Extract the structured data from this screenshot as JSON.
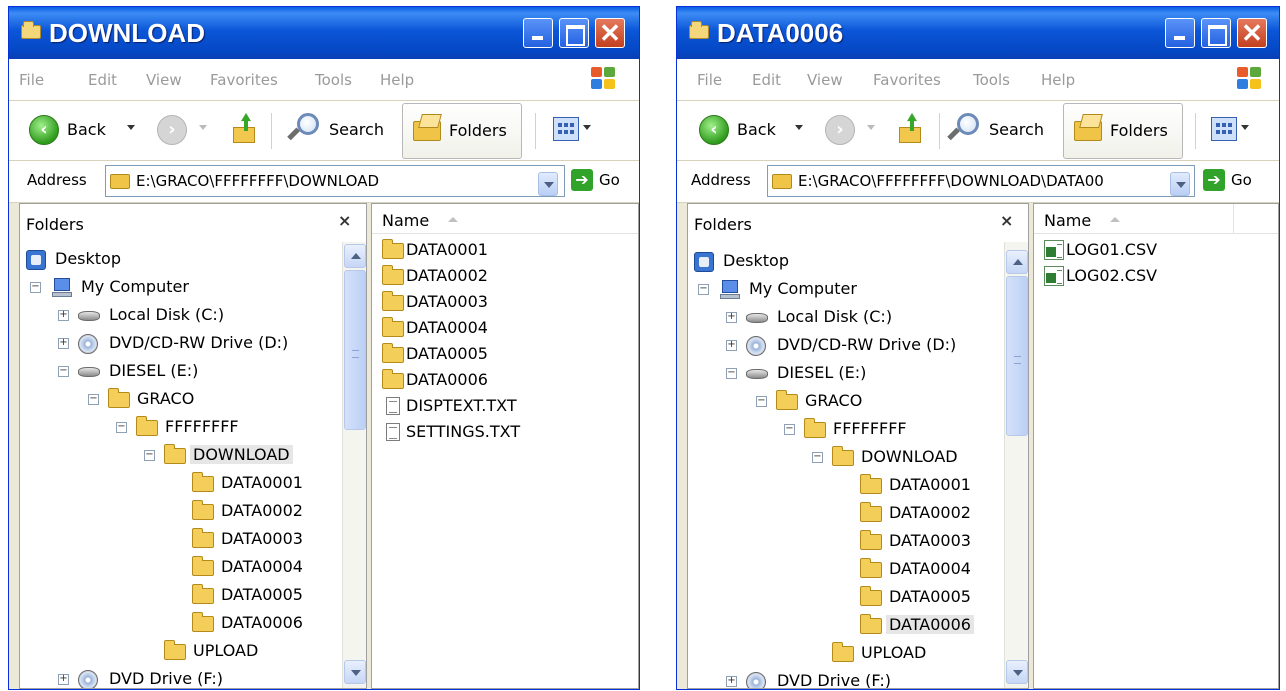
{
  "windows": [
    {
      "title": "DOWNLOAD",
      "menu": [
        "File",
        "Edit",
        "View",
        "Favorites",
        "Tools",
        "Help"
      ],
      "toolbar": {
        "back": "Back",
        "search": "Search",
        "folders": "Folders"
      },
      "address": {
        "label": "Address",
        "value": "E:\\GRACO\\FFFFFFFF\\DOWNLOAD",
        "go": "Go"
      },
      "folders_pane": {
        "title": "Folders",
        "close": "×",
        "tree": [
          {
            "label": "Desktop",
            "icon": "desktop-icon"
          },
          {
            "label": "My Computer",
            "icon": "computer-icon",
            "expander": "−"
          },
          {
            "label": "Local Disk (C:)",
            "icon": "disk-icon",
            "expander": "+"
          },
          {
            "label": "DVD/CD-RW Drive (D:)",
            "icon": "dvd-icon",
            "expander": "+"
          },
          {
            "label": "DIESEL (E:)",
            "icon": "disk-icon",
            "expander": "−"
          },
          {
            "label": "GRACO",
            "icon": "folder-icon",
            "expander": "−"
          },
          {
            "label": "FFFFFFFF",
            "icon": "folder-icon",
            "expander": "−"
          },
          {
            "label": "DOWNLOAD",
            "icon": "folder-icon",
            "expander": "−",
            "selected": true
          },
          {
            "label": "DATA0001",
            "icon": "folder-icon"
          },
          {
            "label": "DATA0002",
            "icon": "folder-icon"
          },
          {
            "label": "DATA0003",
            "icon": "folder-icon"
          },
          {
            "label": "DATA0004",
            "icon": "folder-icon"
          },
          {
            "label": "DATA0005",
            "icon": "folder-icon"
          },
          {
            "label": "DATA0006",
            "icon": "folder-icon"
          },
          {
            "label": "UPLOAD",
            "icon": "folder-icon"
          },
          {
            "label": "DVD Drive (F:)",
            "icon": "dvd-icon",
            "expander": "+"
          }
        ]
      },
      "files": {
        "column": "Name",
        "items": [
          {
            "name": "DATA0001",
            "icon": "folder-icon"
          },
          {
            "name": "DATA0002",
            "icon": "folder-icon"
          },
          {
            "name": "DATA0003",
            "icon": "folder-icon"
          },
          {
            "name": "DATA0004",
            "icon": "folder-icon"
          },
          {
            "name": "DATA0005",
            "icon": "folder-icon"
          },
          {
            "name": "DATA0006",
            "icon": "folder-icon"
          },
          {
            "name": "DISPTEXT.TXT",
            "icon": "text-file-icon"
          },
          {
            "name": "SETTINGS.TXT",
            "icon": "text-file-icon"
          }
        ]
      }
    },
    {
      "title": "DATA0006",
      "menu": [
        "File",
        "Edit",
        "View",
        "Favorites",
        "Tools",
        "Help"
      ],
      "toolbar": {
        "back": "Back",
        "search": "Search",
        "folders": "Folders"
      },
      "address": {
        "label": "Address",
        "value": "E:\\GRACO\\FFFFFFFF\\DOWNLOAD\\DATA00",
        "go": "Go"
      },
      "folders_pane": {
        "title": "Folders",
        "close": "×",
        "tree": [
          {
            "label": "Desktop",
            "icon": "desktop-icon"
          },
          {
            "label": "My Computer",
            "icon": "computer-icon",
            "expander": "−"
          },
          {
            "label": "Local Disk (C:)",
            "icon": "disk-icon",
            "expander": "+"
          },
          {
            "label": "DVD/CD-RW Drive (D:)",
            "icon": "dvd-icon",
            "expander": "+"
          },
          {
            "label": "DIESEL (E:)",
            "icon": "disk-icon",
            "expander": "−"
          },
          {
            "label": "GRACO",
            "icon": "folder-icon",
            "expander": "−"
          },
          {
            "label": "FFFFFFFF",
            "icon": "folder-icon",
            "expander": "−"
          },
          {
            "label": "DOWNLOAD",
            "icon": "folder-icon",
            "expander": "−"
          },
          {
            "label": "DATA0001",
            "icon": "folder-icon"
          },
          {
            "label": "DATA0002",
            "icon": "folder-icon"
          },
          {
            "label": "DATA0003",
            "icon": "folder-icon"
          },
          {
            "label": "DATA0004",
            "icon": "folder-icon"
          },
          {
            "label": "DATA0005",
            "icon": "folder-icon"
          },
          {
            "label": "DATA0006",
            "icon": "folder-icon",
            "selected": true
          },
          {
            "label": "UPLOAD",
            "icon": "folder-icon"
          },
          {
            "label": "DVD Drive (F:)",
            "icon": "dvd-icon",
            "expander": "+"
          }
        ]
      },
      "files": {
        "column": "Name",
        "items": [
          {
            "name": "LOG01.CSV",
            "icon": "csv-file-icon"
          },
          {
            "name": "LOG02.CSV",
            "icon": "csv-file-icon"
          }
        ]
      }
    }
  ]
}
